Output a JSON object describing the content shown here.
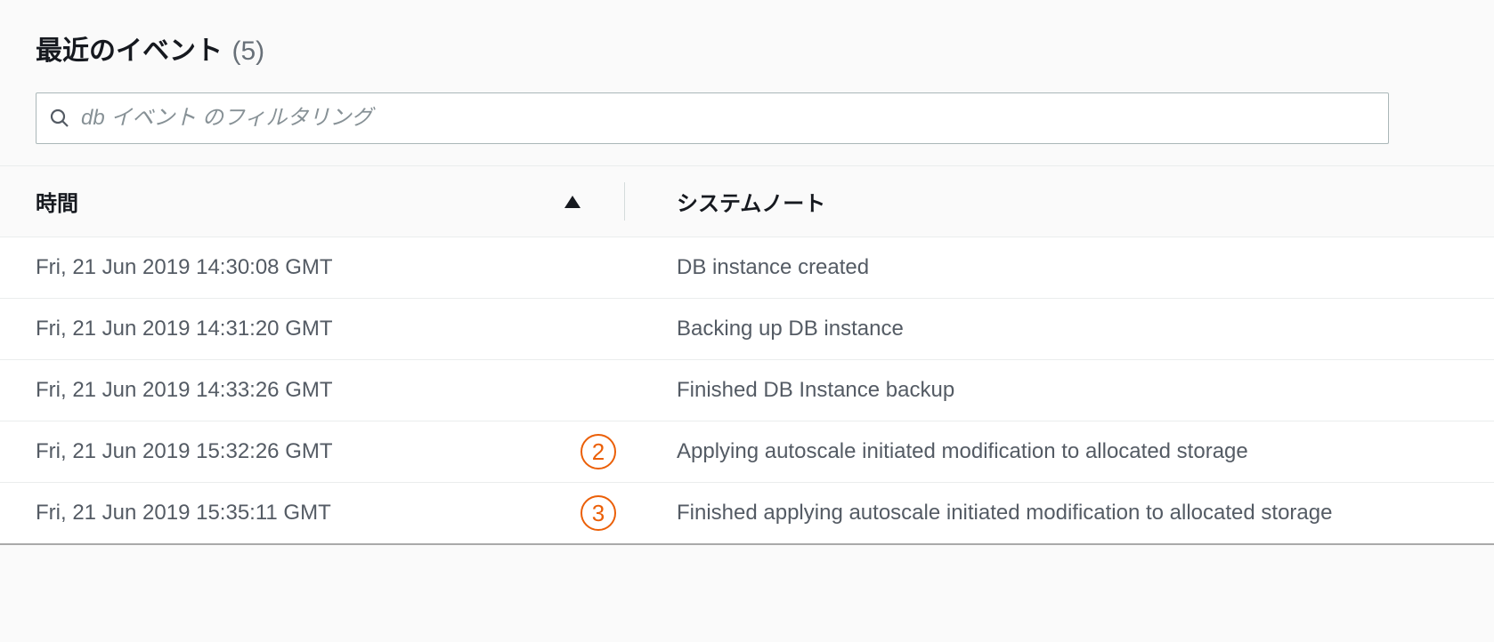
{
  "header": {
    "title": "最近のイベント",
    "count": "(5)"
  },
  "search": {
    "placeholder": "db イベント のフィルタリング"
  },
  "table": {
    "columns": {
      "time": "時間",
      "note": "システムノート"
    },
    "rows": [
      {
        "time": "Fri, 21 Jun 2019 14:30:08 GMT",
        "note": "DB instance created",
        "badge": ""
      },
      {
        "time": "Fri, 21 Jun 2019 14:31:20 GMT",
        "note": "Backing up DB instance",
        "badge": ""
      },
      {
        "time": "Fri, 21 Jun 2019 14:33:26 GMT",
        "note": "Finished DB Instance backup",
        "badge": ""
      },
      {
        "time": "Fri, 21 Jun 2019 15:32:26 GMT",
        "note": "Applying autoscale initiated modification to allocated storage",
        "badge": "2"
      },
      {
        "time": "Fri, 21 Jun 2019 15:35:11 GMT",
        "note": "Finished applying autoscale initiated modification to allocated storage",
        "badge": "3"
      }
    ]
  }
}
